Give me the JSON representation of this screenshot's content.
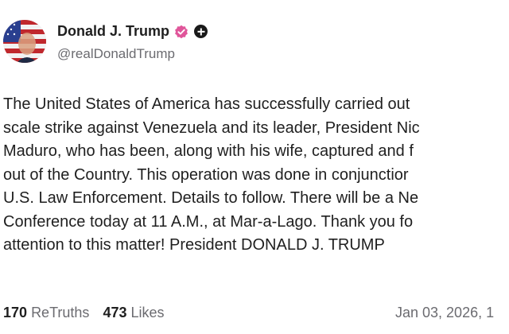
{
  "author": {
    "display_name": "Donald J. Trump",
    "handle": "@realDonaldTrump",
    "avatar_icon": "profile-photo-flag",
    "verified_icon": "verified-badge-icon",
    "verified_color": "#e0559a",
    "plus_icon": "plus-circle-icon"
  },
  "post": {
    "lines": [
      "The United States of America has successfully carried out",
      "scale strike against Venezuela and its leader, President Nic",
      "Maduro, who has been, along with his wife, captured and f",
      "out of the Country. This operation was done in conjunctior",
      "U.S. Law Enforcement. Details to follow. There will be a Ne",
      "Conference today at 11 A.M., at Mar-a-Lago. Thank you fo",
      "attention to this matter! President DONALD J. TRUMP"
    ]
  },
  "stats": {
    "retruths_count": "170",
    "retruths_label": "ReTruths",
    "likes_count": "473",
    "likes_label": "Likes"
  },
  "timestamp": "Jan 03, 2026, 1"
}
